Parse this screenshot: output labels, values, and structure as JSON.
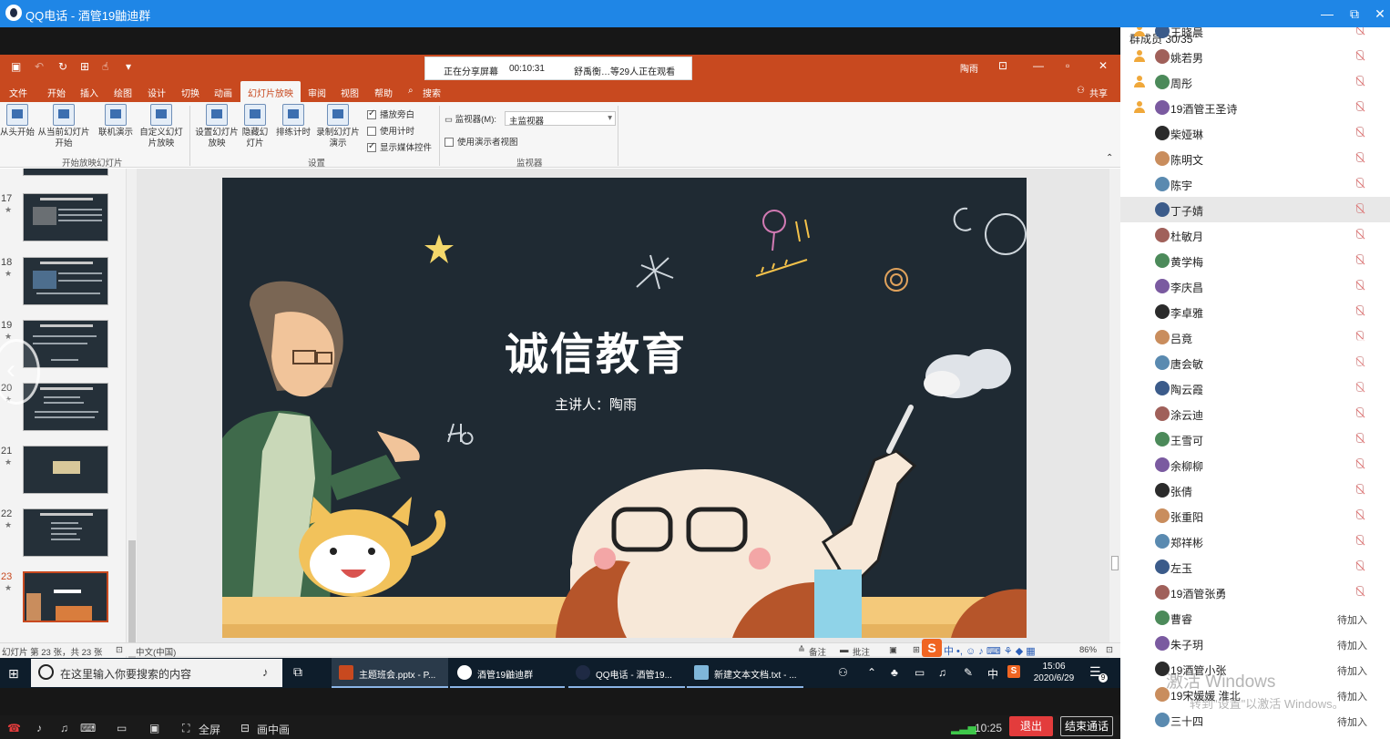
{
  "window": {
    "title": "QQ电话 - 酒管19鼬迪群",
    "controls": [
      "—",
      "⧉",
      "✕"
    ]
  },
  "share_banner": {
    "status": "正在分享屏幕",
    "duration": "00:10:31",
    "viewers": "舒禹衡…等29人正在观看"
  },
  "ppt": {
    "user": "陶雨",
    "tabs": [
      "文件",
      "开始",
      "插入",
      "绘图",
      "设计",
      "切换",
      "动画",
      "幻灯片放映",
      "审阅",
      "视图",
      "帮助",
      "搜索"
    ],
    "active_tab": "幻灯片放映",
    "share_label": "共享",
    "ribbon": {
      "from_start": "从头开始",
      "from_current": "从当前幻灯片开始",
      "online": "联机演示",
      "custom": "自定义幻灯片放映",
      "group1": "开始放映幻灯片",
      "setup": "设置幻灯片放映",
      "hide": "隐藏幻灯片",
      "rehearse": "排练计时",
      "record": "录制幻灯片演示",
      "play_narration": "播放旁白",
      "use_timing": "使用计时",
      "show_media": "显示媒体控件",
      "group2": "设置",
      "monitor_label": "监视器(M):",
      "monitor_value": "主监视器",
      "presenter_view": "使用演示者视图",
      "group3": "监视器"
    },
    "thumbnails": [
      {
        "num": "17"
      },
      {
        "num": "18"
      },
      {
        "num": "19"
      },
      {
        "num": "20"
      },
      {
        "num": "21"
      },
      {
        "num": "22"
      },
      {
        "num": "23"
      }
    ],
    "slide": {
      "title": "诚信教育",
      "subtitle": "主讲人：陶雨"
    },
    "status": {
      "slide_pos": "幻灯片 第 23 张，共 23 张",
      "language": "中文(中国)",
      "notes": "备注",
      "comments": "批注",
      "zoom": "86%"
    }
  },
  "taskbar": {
    "search_placeholder": "在这里输入你要搜索的内容",
    "items": [
      "主题班会.pptx - P...",
      "酒管19鼬迪群",
      "QQ电话 - 酒管19...",
      "新建文本文档.txt - ..."
    ],
    "ime": "中",
    "time": "15:06",
    "date": "2020/6/29",
    "notif_count": "9"
  },
  "call_bar": {
    "fullscreen": "全屏",
    "pip": "画中画",
    "time": "10:25",
    "exit": "退出",
    "end_call": "结束通话"
  },
  "members": {
    "header": "群成员 30/35",
    "list": [
      {
        "name": "王晓晨",
        "admin": true,
        "mic": true
      },
      {
        "name": "姚若男",
        "admin": true,
        "mic": true
      },
      {
        "name": "周彤",
        "admin": true,
        "mic": true
      },
      {
        "name": "19酒管王圣诗",
        "admin": true,
        "mic": true
      },
      {
        "name": "柴娅琳",
        "admin": false,
        "mic": true
      },
      {
        "name": "陈明文",
        "admin": false,
        "mic": true
      },
      {
        "name": "陈宇",
        "admin": false,
        "mic": true
      },
      {
        "name": "丁子婧",
        "admin": false,
        "mic": true,
        "highlight": true
      },
      {
        "name": "杜敏月",
        "admin": false,
        "mic": true
      },
      {
        "name": "黄学梅",
        "admin": false,
        "mic": true
      },
      {
        "name": "李庆昌",
        "admin": false,
        "mic": true
      },
      {
        "name": "李卓雅",
        "admin": false,
        "mic": true
      },
      {
        "name": "吕竟",
        "admin": false,
        "mic": true
      },
      {
        "name": "唐会敏",
        "admin": false,
        "mic": true
      },
      {
        "name": "陶云霞",
        "admin": false,
        "mic": true
      },
      {
        "name": "涂云迪",
        "admin": false,
        "mic": true
      },
      {
        "name": "王雪可",
        "admin": false,
        "mic": true
      },
      {
        "name": "余柳柳",
        "admin": false,
        "mic": true
      },
      {
        "name": "张倩",
        "admin": false,
        "mic": true
      },
      {
        "name": "张重阳",
        "admin": false,
        "mic": true
      },
      {
        "name": "郑祥彬",
        "admin": false,
        "mic": true
      },
      {
        "name": "左玉",
        "admin": false,
        "mic": true
      },
      {
        "name": "19酒管张勇",
        "admin": false,
        "mic": true
      },
      {
        "name": "曹睿",
        "admin": false,
        "status": "待加入"
      },
      {
        "name": "朱子玥",
        "admin": false,
        "status": "待加入"
      },
      {
        "name": "19酒管小张",
        "admin": false,
        "status": "待加入"
      },
      {
        "name": "19宋媛媛 淮北",
        "admin": false,
        "status": "待加入"
      },
      {
        "name": "三十四",
        "admin": false,
        "status": "待加入"
      }
    ]
  },
  "watermark": {
    "line1": "激活 Windows",
    "line2": "转到\"设置\"以激活 Windows。"
  },
  "colors": {
    "qq_blue": "#1f86e6",
    "ppt_orange": "#c8491f",
    "slide_bg": "#1f2a33",
    "exit_red": "#e33c3c"
  }
}
